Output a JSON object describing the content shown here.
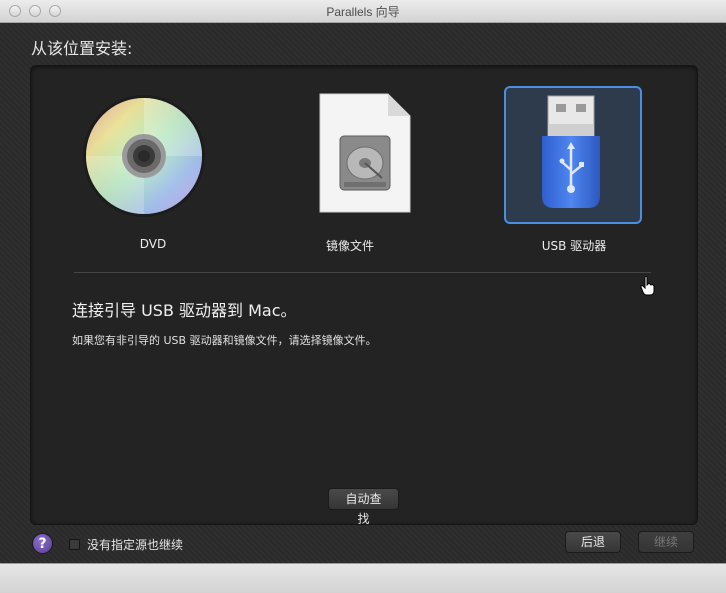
{
  "window": {
    "title": "Parallels 向导"
  },
  "heading": "从该位置安装:",
  "options": [
    {
      "label": "DVD",
      "icon": "dvd-disc-icon",
      "selected": false
    },
    {
      "label": "镜像文件",
      "icon": "disk-image-file-icon",
      "selected": false
    },
    {
      "label": "USB 驱动器",
      "icon": "usb-drive-icon",
      "selected": true
    }
  ],
  "message": {
    "title": "连接引导 USB 驱动器到 Mac。",
    "subtitle": "如果您有非引导的 USB 驱动器和镜像文件，请选择镜像文件。"
  },
  "buttons": {
    "auto_find": "自动查找",
    "back": "后退",
    "continue": "继续"
  },
  "footer": {
    "help": "?",
    "checkbox_label": "没有指定源也继续",
    "checkbox_checked": false
  },
  "colors": {
    "selection": "#4a90e2",
    "usb_body": "#3f6fd8",
    "help_button": "#6a4fb0"
  }
}
